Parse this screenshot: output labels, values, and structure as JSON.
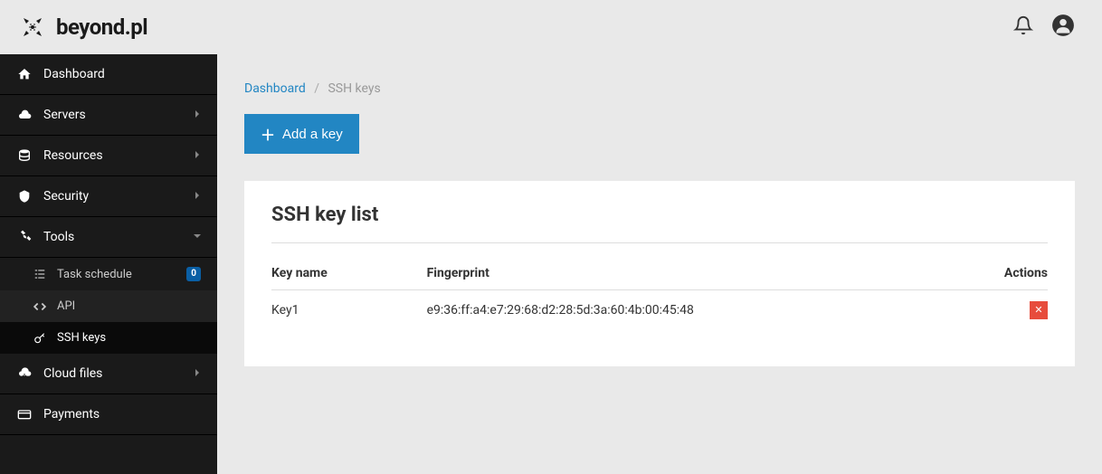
{
  "header": {
    "logo_text": "beyond.pl"
  },
  "sidebar": {
    "items": [
      {
        "label": "Dashboard",
        "icon": "home"
      },
      {
        "label": "Servers",
        "icon": "cloud",
        "expand": true
      },
      {
        "label": "Resources",
        "icon": "database",
        "expand": true
      },
      {
        "label": "Security",
        "icon": "shield",
        "expand": true
      },
      {
        "label": "Tools",
        "icon": "wrench",
        "expand": true,
        "open": true
      },
      {
        "label": "Cloud files",
        "icon": "cloud-down",
        "expand": true
      },
      {
        "label": "Payments",
        "icon": "card"
      }
    ],
    "tools_sub": [
      {
        "label": "Task schedule",
        "icon": "list",
        "badge": "0"
      },
      {
        "label": "API",
        "icon": "code"
      },
      {
        "label": "SSH keys",
        "icon": "key",
        "active": true
      }
    ]
  },
  "breadcrumb": {
    "root": "Dashboard",
    "current": "SSH keys"
  },
  "actions": {
    "add_key_label": "Add a key"
  },
  "panel": {
    "title": "SSH key list",
    "columns": {
      "name": "Key name",
      "fingerprint": "Fingerprint",
      "actions": "Actions"
    },
    "rows": [
      {
        "name": "Key1",
        "fingerprint": "e9:36:ff:a4:e7:29:68:d2:28:5d:3a:60:4b:00:45:48"
      }
    ]
  }
}
